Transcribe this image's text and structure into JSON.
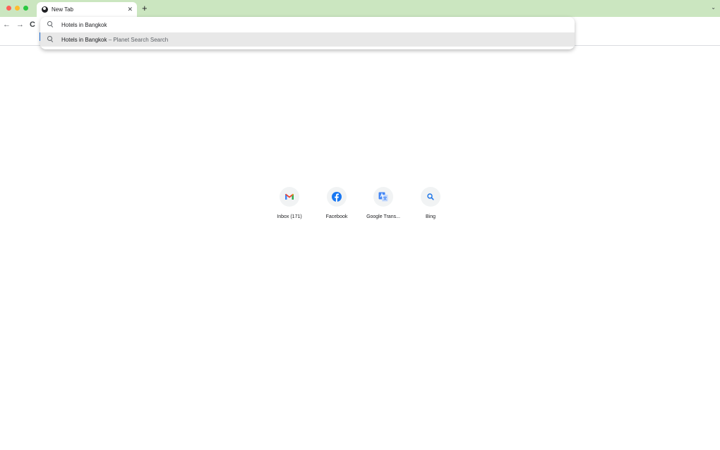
{
  "browser": {
    "tab": {
      "title": "New Tab",
      "close_glyph": "✕",
      "favicon": "globe-icon"
    },
    "new_tab_glyph": "+",
    "tab_search_glyph": "⌄",
    "toolbar": {
      "back_glyph": "←",
      "forward_glyph": "→",
      "reload_glyph": "C"
    },
    "omnibox": {
      "query": "Hotels in Bangkok",
      "suggestion": {
        "text": "Hotels in Bangkok",
        "separator": " – ",
        "engine": "Planet Search Search"
      }
    }
  },
  "shortcuts": [
    {
      "label": "Inbox (171)",
      "icon": "gmail-icon"
    },
    {
      "label": "Facebook",
      "icon": "facebook-icon"
    },
    {
      "label": "Google Trans...",
      "icon": "google-translate-icon"
    },
    {
      "label": "Bing",
      "icon": "search-icon"
    }
  ],
  "colors": {
    "tabstrip": "#cbe6c0",
    "facebook_blue": "#1877f2",
    "translate_blue": "#4285f4"
  }
}
